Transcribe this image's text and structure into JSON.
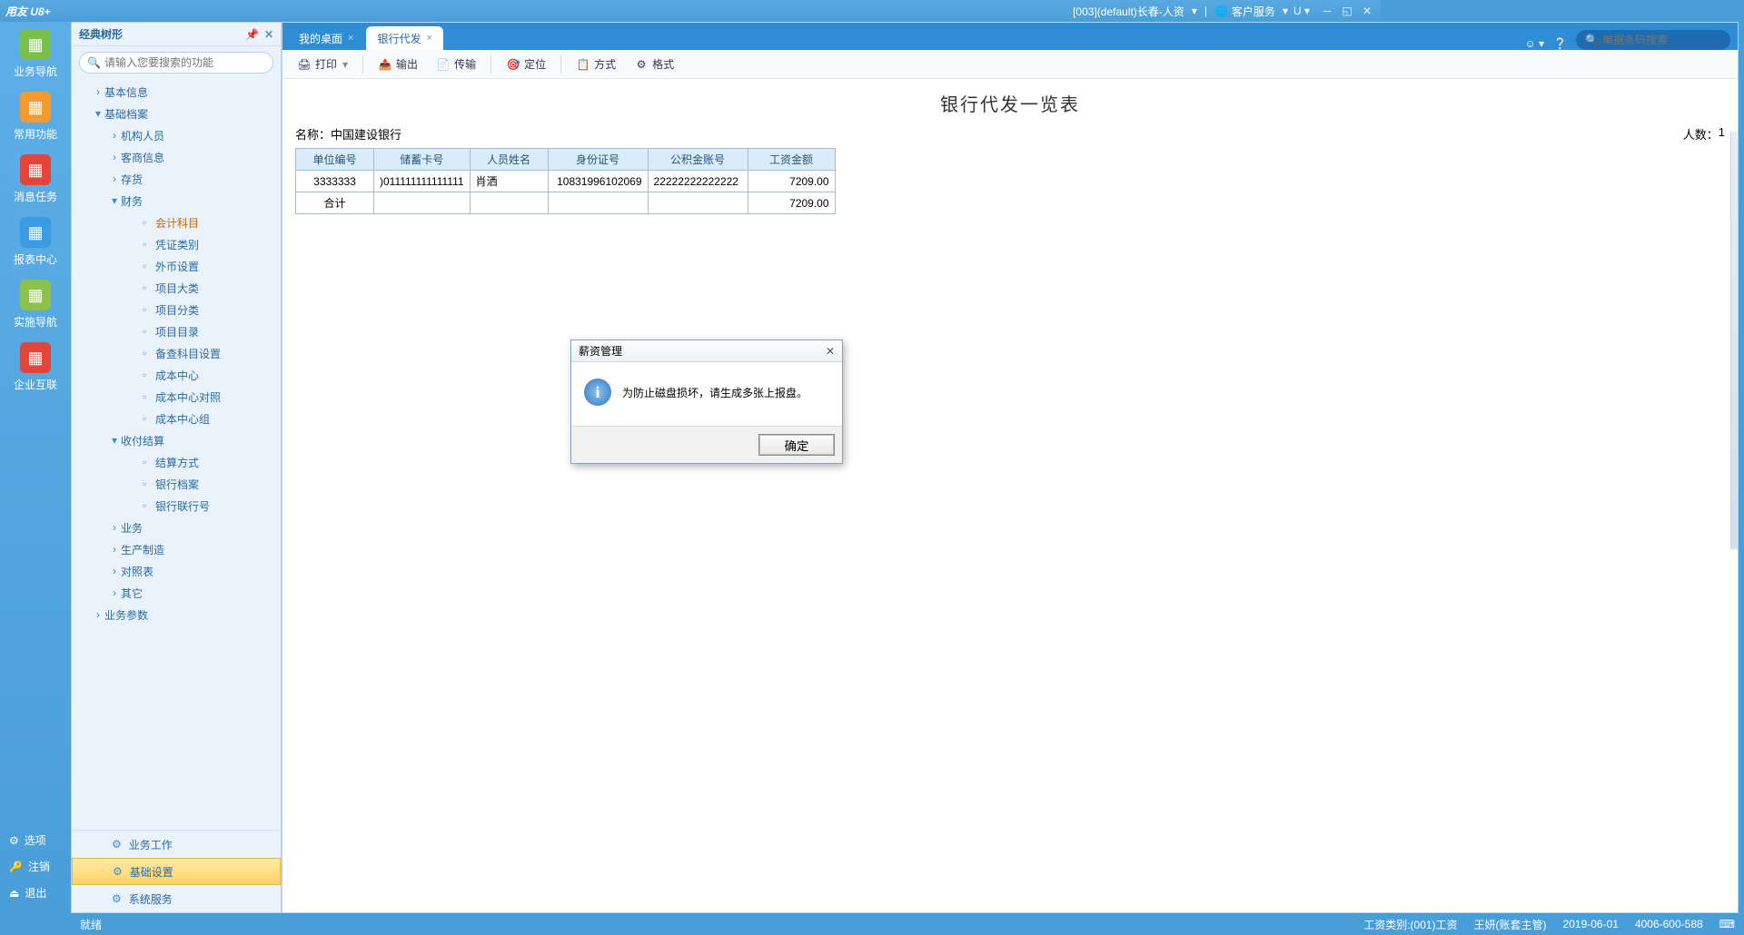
{
  "titlebar": {
    "logo": "用友 U8+",
    "account": "[003](default)长春-人资",
    "service": "客户服务"
  },
  "rail": {
    "items": [
      {
        "label": "业务导航",
        "color": "#7ac04a"
      },
      {
        "label": "常用功能",
        "color": "#f59a2f"
      },
      {
        "label": "消息任务",
        "color": "#e2453a"
      },
      {
        "label": "报表中心",
        "color": "#3a9be2"
      },
      {
        "label": "实施导航",
        "color": "#8bc34a"
      },
      {
        "label": "企业互联",
        "color": "#e2453a"
      }
    ],
    "footer": [
      {
        "icon": "gear",
        "label": "选项"
      },
      {
        "icon": "key",
        "label": "注销"
      },
      {
        "icon": "exit",
        "label": "退出"
      }
    ]
  },
  "tree": {
    "title": "经典树形",
    "search_placeholder": "请输入您要搜索的功能",
    "bottom": [
      {
        "label": "业务工作",
        "sel": false
      },
      {
        "label": "基础设置",
        "sel": true
      },
      {
        "label": "系统服务",
        "sel": false
      }
    ],
    "nodes": [
      {
        "depth": 1,
        "tw": "›",
        "label": "基本信息"
      },
      {
        "depth": 1,
        "tw": "▾",
        "label": "基础档案"
      },
      {
        "depth": 2,
        "tw": "›",
        "label": "机构人员"
      },
      {
        "depth": 2,
        "tw": "›",
        "label": "客商信息"
      },
      {
        "depth": 2,
        "tw": "›",
        "label": "存货"
      },
      {
        "depth": 2,
        "tw": "▾",
        "label": "财务"
      },
      {
        "depth": 3,
        "tw": "",
        "label": "会计科目",
        "leaf": true,
        "active": true
      },
      {
        "depth": 3,
        "tw": "",
        "label": "凭证类别",
        "leaf": true
      },
      {
        "depth": 3,
        "tw": "",
        "label": "外币设置",
        "leaf": true
      },
      {
        "depth": 3,
        "tw": "",
        "label": "项目大类",
        "leaf": true
      },
      {
        "depth": 3,
        "tw": "",
        "label": "项目分类",
        "leaf": true
      },
      {
        "depth": 3,
        "tw": "",
        "label": "项目目录",
        "leaf": true
      },
      {
        "depth": 3,
        "tw": "",
        "label": "备查科目设置",
        "leaf": true
      },
      {
        "depth": 3,
        "tw": "",
        "label": "成本中心",
        "leaf": true
      },
      {
        "depth": 3,
        "tw": "",
        "label": "成本中心对照",
        "leaf": true
      },
      {
        "depth": 3,
        "tw": "",
        "label": "成本中心组",
        "leaf": true
      },
      {
        "depth": 2,
        "tw": "▾",
        "label": "收付结算"
      },
      {
        "depth": 3,
        "tw": "",
        "label": "结算方式",
        "leaf": true
      },
      {
        "depth": 3,
        "tw": "",
        "label": "银行档案",
        "leaf": true
      },
      {
        "depth": 3,
        "tw": "",
        "label": "银行联行号",
        "leaf": true
      },
      {
        "depth": 2,
        "tw": "›",
        "label": "业务"
      },
      {
        "depth": 2,
        "tw": "›",
        "label": "生产制造"
      },
      {
        "depth": 2,
        "tw": "›",
        "label": "对照表"
      },
      {
        "depth": 2,
        "tw": "›",
        "label": "其它"
      },
      {
        "depth": 1,
        "tw": "›",
        "label": "业务参数"
      }
    ]
  },
  "tabs": {
    "items": [
      {
        "label": "我的桌面",
        "active": false
      },
      {
        "label": "银行代发",
        "active": true
      }
    ],
    "search_placeholder": "单据条码搜索"
  },
  "toolbar": {
    "print": "打印",
    "output": "输出",
    "transfer": "传输",
    "locate": "定位",
    "mode": "方式",
    "format": "格式"
  },
  "page": {
    "title": "银行代发一览表",
    "name_label": "名称：",
    "name_value": "中国建设银行",
    "count_label": "人数：",
    "count_value": "1"
  },
  "grid": {
    "headers": [
      "单位编号",
      "储蓄卡号",
      "人员姓名",
      "身份证号",
      "公积金账号",
      "工资金额"
    ],
    "rows": [
      {
        "c0": "3333333",
        "c1": ")011111111111111",
        "c2": "肖洒",
        "c3": "10831996102069",
        "c4": "22222222222222",
        "c5": "7209.00"
      }
    ],
    "total_label": "合计",
    "total_value": "7209.00"
  },
  "dialog": {
    "title": "薪资管理",
    "message": "为防止磁盘损坏，请生成多张上报盘。",
    "ok": "确定"
  },
  "status": {
    "ready": "就绪",
    "salary_type": "工资类别:(001)工资",
    "user": "王妍(账套主管)",
    "date": "2019-06-01",
    "hotline": "4006-600-588"
  }
}
